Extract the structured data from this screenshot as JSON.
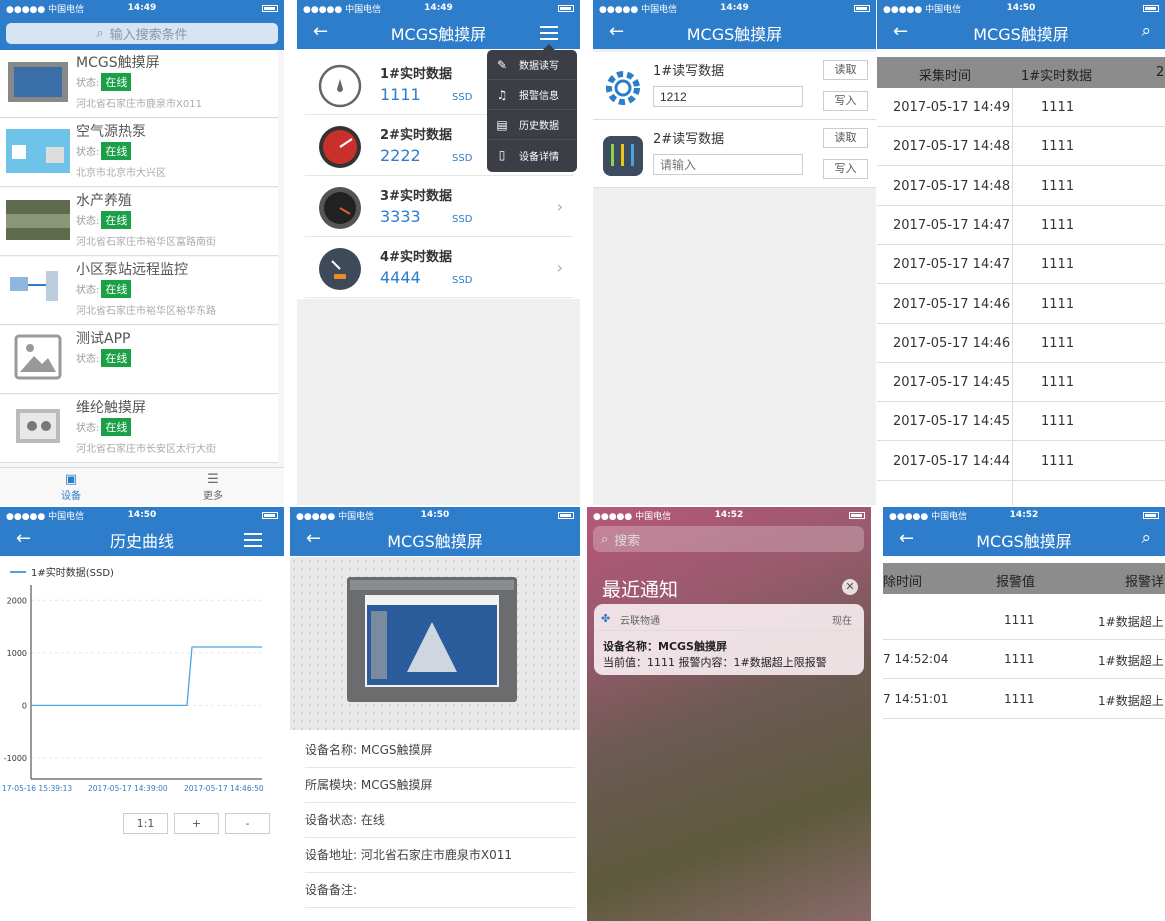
{
  "status_bar": {
    "carrier": "●●●●● 中国电信",
    "panel_times": [
      "14:49",
      "14:49",
      "14:49",
      "14:50",
      "14:50",
      "14:50",
      "14:52",
      "14:52"
    ]
  },
  "p1": {
    "search_placeholder": "输入搜索条件",
    "state_label": "状态:",
    "devices": [
      {
        "name": "MCGS触摸屏",
        "status": "在线",
        "address": "河北省石家庄市鹿泉市X011"
      },
      {
        "name": "空气源热泵",
        "status": "在线",
        "address": "北京市北京市大兴区"
      },
      {
        "name": "水产养殖",
        "status": "在线",
        "address": "河北省石家庄市裕华区富路南街"
      },
      {
        "name": "小区泵站远程监控",
        "status": "在线",
        "address": "河北省石家庄市裕华区裕华东路"
      },
      {
        "name": "测试APP",
        "status": "在线",
        "address": ""
      },
      {
        "name": "维纶触摸屏",
        "status": "在线",
        "address": "河北省石家庄市长安区太行大街"
      }
    ],
    "tabs": [
      {
        "label": "设备",
        "icon": "device-icon"
      },
      {
        "label": "更多",
        "icon": "list-icon"
      }
    ]
  },
  "p2": {
    "title": "MCGS触摸屏",
    "items": [
      {
        "name": "1#实时数据",
        "value": "1111",
        "unit": "SSD"
      },
      {
        "name": "2#实时数据",
        "value": "2222",
        "unit": "SSD"
      },
      {
        "name": "3#实时数据",
        "value": "3333",
        "unit": "SSD"
      },
      {
        "name": "4#实时数据",
        "value": "4444",
        "unit": "SSD"
      }
    ],
    "menu": [
      {
        "label": "数据读写",
        "icon": "edit-icon"
      },
      {
        "label": "报警信息",
        "icon": "bell-icon"
      },
      {
        "label": "历史数据",
        "icon": "table-icon"
      },
      {
        "label": "设备详情",
        "icon": "document-icon"
      }
    ]
  },
  "p3": {
    "title": "MCGS触摸屏",
    "rows": [
      {
        "name": "1#读写数据",
        "value": "1212",
        "placeholder": "",
        "read": "读取",
        "write": "写入"
      },
      {
        "name": "2#读写数据",
        "value": "",
        "placeholder": "请输入",
        "read": "读取",
        "write": "写入"
      }
    ]
  },
  "p4": {
    "title": "MCGS触摸屏",
    "headers": [
      "采集时间",
      "1#实时数据",
      "2"
    ],
    "rows": [
      {
        "time": "2017-05-17 14:49",
        "value": "1111"
      },
      {
        "time": "2017-05-17 14:48",
        "value": "1111"
      },
      {
        "time": "2017-05-17 14:48",
        "value": "1111"
      },
      {
        "time": "2017-05-17 14:47",
        "value": "1111"
      },
      {
        "time": "2017-05-17 14:47",
        "value": "1111"
      },
      {
        "time": "2017-05-17 14:46",
        "value": "1111"
      },
      {
        "time": "2017-05-17 14:46",
        "value": "1111"
      },
      {
        "time": "2017-05-17 14:45",
        "value": "1111"
      },
      {
        "time": "2017-05-17 14:45",
        "value": "1111"
      },
      {
        "time": "2017-05-17 14:44",
        "value": "1111"
      }
    ]
  },
  "p5": {
    "title": "历史曲线",
    "zoom_buttons": [
      "1:1",
      "+",
      "-"
    ],
    "chart_data": {
      "type": "line",
      "series": [
        {
          "name": "1#实时数据(SSD)",
          "color": "#4fa3e0",
          "points": [
            [
              "2017-05-16 15:39:13",
              0
            ],
            [
              "2017-05-17 14:44:50",
              0
            ],
            [
              "2017-05-17 14:45:00",
              1111
            ],
            [
              "2017-05-17 14:52:00",
              1111
            ]
          ]
        }
      ],
      "x_tick_labels": [
        "17-05-16 15:39:13",
        "2017-05-17 14:39:00",
        "2017-05-17 14:46:50"
      ],
      "y_ticks": [
        2000,
        1000,
        0,
        -1000
      ],
      "ylim": [
        -1400,
        2100
      ]
    }
  },
  "p6": {
    "title": "MCGS触摸屏",
    "fields": [
      {
        "label": "设备名称:",
        "value": "MCGS触摸屏"
      },
      {
        "label": "所属模块:",
        "value": "MCGS触摸屏"
      },
      {
        "label": "设备状态:",
        "value": "在线"
      },
      {
        "label": "设备地址:",
        "value": "河北省石家庄市鹿泉市X011"
      },
      {
        "label": "设备备注:",
        "value": ""
      }
    ]
  },
  "p7": {
    "search": "搜索",
    "heading": "最近通知",
    "app": "云联物通",
    "when": "现在",
    "line1": "设备名称：MCGS触摸屏",
    "line2": "当前值：1111  报警内容：1#数据超上限报警"
  },
  "p8": {
    "title": "MCGS触摸屏",
    "headers": [
      "除时间",
      "报警值",
      "报警详"
    ],
    "rows": [
      {
        "time": "",
        "value": "1111",
        "detail": "1#数据超上"
      },
      {
        "time": "7 14:52:04",
        "value": "1111",
        "detail": "1#数据超上"
      },
      {
        "time": "7 14:51:01",
        "value": "1111",
        "detail": "1#数据超上"
      }
    ]
  }
}
